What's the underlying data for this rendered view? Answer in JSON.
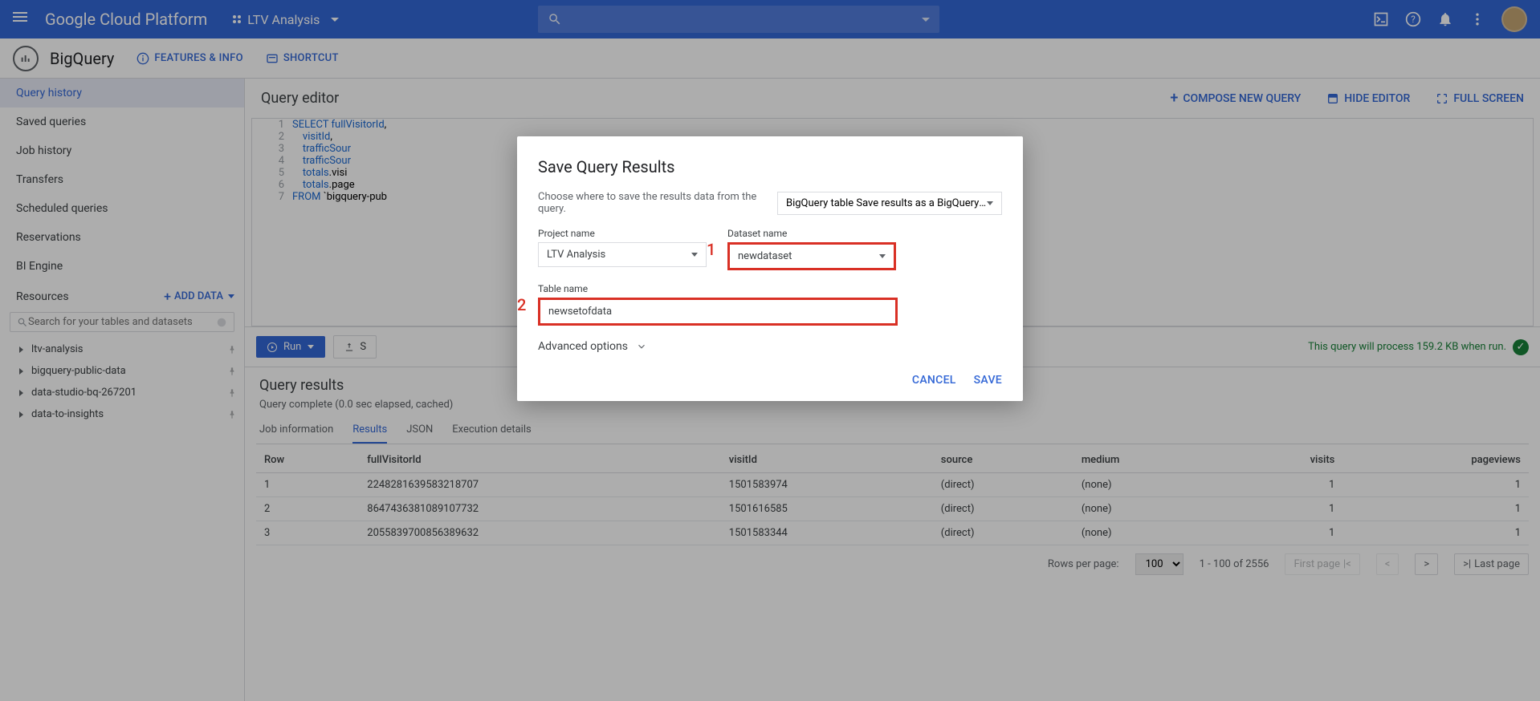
{
  "topbar": {
    "logo": "Google Cloud Platform",
    "project": "LTV Analysis"
  },
  "subheader": {
    "product": "BigQuery",
    "features": "FEATURES & INFO",
    "shortcut": "SHORTCUT"
  },
  "sidebar": {
    "items": [
      "Query history",
      "Saved queries",
      "Job history",
      "Transfers",
      "Scheduled queries",
      "Reservations",
      "BI Engine"
    ],
    "resources_label": "Resources",
    "add_data": "ADD DATA",
    "search_placeholder": "Search for your tables and datasets",
    "tree": [
      "ltv-analysis",
      "bigquery-public-data",
      "data-studio-bq-267201",
      "data-to-insights"
    ]
  },
  "editor": {
    "title": "Query editor",
    "actions": {
      "compose": "COMPOSE NEW QUERY",
      "hide": "HIDE EDITOR",
      "full": "FULL SCREEN"
    },
    "lines": [
      {
        "n": "1",
        "html": "<span class='kw'>SELECT</span> <span class='fld'>fullVisitorId</span>,"
      },
      {
        "n": "2",
        "html": "&nbsp;&nbsp;&nbsp;&nbsp;<span class='fld'>visitId</span>,"
      },
      {
        "n": "3",
        "html": "&nbsp;&nbsp;&nbsp;&nbsp;<span class='fld'>trafficSour</span>"
      },
      {
        "n": "4",
        "html": "&nbsp;&nbsp;&nbsp;&nbsp;<span class='fld'>trafficSour</span>"
      },
      {
        "n": "5",
        "html": "&nbsp;&nbsp;&nbsp;&nbsp;<span class='fld'>totals</span>.visi"
      },
      {
        "n": "6",
        "html": "&nbsp;&nbsp;&nbsp;&nbsp;<span class='fld'>totals</span>.page"
      },
      {
        "n": "7",
        "html": "<span class='kw'>FROM</span> `bigquery-pub"
      }
    ]
  },
  "runbar": {
    "run": "Run",
    "save": "S",
    "status": "This query will process 159.2 KB when run."
  },
  "results": {
    "title": "Query results",
    "complete": "Query complete (0.0 sec elapsed, cached)",
    "tabs": [
      "Job information",
      "Results",
      "JSON",
      "Execution details"
    ],
    "columns": [
      "Row",
      "fullVisitorId",
      "visitId",
      "source",
      "medium",
      "visits",
      "pageviews"
    ],
    "rows": [
      {
        "row": "1",
        "fullVisitorId": "2248281639583218707",
        "visitId": "1501583974",
        "source": "(direct)",
        "medium": "(none)",
        "visits": "1",
        "pageviews": "1"
      },
      {
        "row": "2",
        "fullVisitorId": "8647436381089107732",
        "visitId": "1501616585",
        "source": "(direct)",
        "medium": "(none)",
        "visits": "1",
        "pageviews": "1"
      },
      {
        "row": "3",
        "fullVisitorId": "2055839700856389632",
        "visitId": "1501583344",
        "source": "(direct)",
        "medium": "(none)",
        "visits": "1",
        "pageviews": "1"
      }
    ],
    "pager": {
      "rpp_label": "Rows per page:",
      "rpp": "100",
      "range": "1 - 100 of 2556",
      "first": "First page",
      "last": "Last page"
    }
  },
  "dialog": {
    "title": "Save Query Results",
    "desc": "Choose where to save the results data from the query.",
    "dest": "BigQuery table Save results as a BigQuery ta…",
    "project_label": "Project name",
    "project_value": "LTV Analysis",
    "dataset_label": "Dataset name",
    "dataset_value": "newdataset",
    "table_label": "Table name",
    "table_value": "newsetofdata",
    "advanced": "Advanced options",
    "cancel": "CANCEL",
    "save": "SAVE",
    "annot1": "1",
    "annot2": "2"
  }
}
